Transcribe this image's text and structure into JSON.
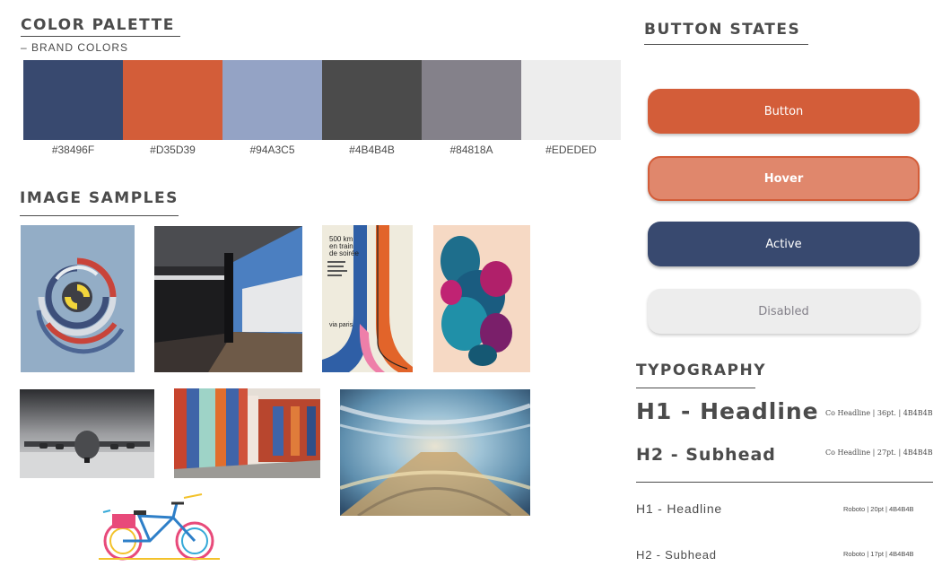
{
  "palette": {
    "title": "COLOR PALETTE",
    "subtitle": "– BRAND COLORS",
    "swatches": [
      {
        "hex": "#38496F",
        "label": "#38496F"
      },
      {
        "hex": "#D35D39",
        "label": "#D35D39"
      },
      {
        "hex": "#94A3C5",
        "label": "#94A3C5"
      },
      {
        "hex": "#4B4B4B",
        "label": "#4B4B4B"
      },
      {
        "hex": "#84818A",
        "label": "#84818A"
      },
      {
        "hex": "#EDEDED",
        "label": "#EDEDED"
      }
    ]
  },
  "images": {
    "title": "IMAGE SAMPLES",
    "items": [
      "circular-graphic-poster",
      "architecture-interior-photo",
      "500km-en-train-poster",
      "ink-cloud-photo",
      "cargo-plane-photo",
      "painted-gallery-room-photo",
      "light-tunnel-motion-photo",
      "bicycle-illustration"
    ],
    "poster_text": {
      "headline_lines": [
        "500 km",
        "en train",
        "de soirée"
      ],
      "footer": "via paris"
    }
  },
  "buttons": {
    "title": "BUTTON STATES",
    "states": [
      {
        "label": "Button",
        "bg": "#D35D39",
        "text": "#FFFFFF"
      },
      {
        "label": "Hover",
        "bg": "#E0876C",
        "border": "#D35D39",
        "text": "#FFFFFF"
      },
      {
        "label": "Active",
        "bg": "#38496F",
        "text": "#FFFFFF"
      },
      {
        "label": "Disabled",
        "bg": "#EDEDED",
        "text": "#84818A"
      }
    ]
  },
  "typography": {
    "title": "TYPOGRAPHY",
    "h1": {
      "label": "H1 - Headline",
      "note": "Co Headline | 36pt. | 4B4B4B"
    },
    "h2": {
      "label": "H2 - Subhead",
      "note": "Co Headline | 27pt. | 4B4B4B"
    },
    "roboto_h1": {
      "label": "H1 - Headline",
      "note": "Roboto | 20pt | 4B4B4B"
    },
    "roboto_h2": {
      "label": "H2 - Subhead",
      "note": "Roboto | 17pt | 4B4B4B"
    }
  }
}
